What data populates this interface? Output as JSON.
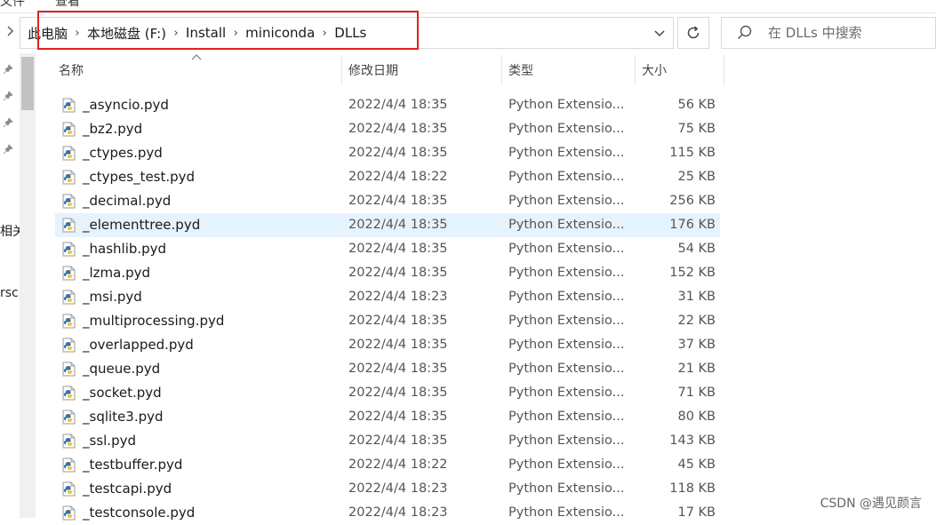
{
  "address": {
    "crumbs": [
      "此电脑",
      "本地磁盘 (F:)",
      "Install",
      "miniconda",
      "DLLs"
    ]
  },
  "search": {
    "placeholder": "在 DLLs 中搜索"
  },
  "ribbon": {
    "left_text": "文件",
    "right_text": "查看"
  },
  "left_pane": {
    "text_1": "相关",
    "text_2": "rsc"
  },
  "columns": {
    "name": "名称",
    "date": "修改日期",
    "type": "类型",
    "size": "大小"
  },
  "files": [
    {
      "name": "_asyncio.pyd",
      "date": "2022/4/4 18:35",
      "type": "Python Extensio...",
      "size": "56 KB"
    },
    {
      "name": "_bz2.pyd",
      "date": "2022/4/4 18:35",
      "type": "Python Extensio...",
      "size": "75 KB"
    },
    {
      "name": "_ctypes.pyd",
      "date": "2022/4/4 18:35",
      "type": "Python Extensio...",
      "size": "115 KB"
    },
    {
      "name": "_ctypes_test.pyd",
      "date": "2022/4/4 18:22",
      "type": "Python Extensio...",
      "size": "25 KB"
    },
    {
      "name": "_decimal.pyd",
      "date": "2022/4/4 18:35",
      "type": "Python Extensio...",
      "size": "256 KB"
    },
    {
      "name": "_elementtree.pyd",
      "date": "2022/4/4 18:35",
      "type": "Python Extensio...",
      "size": "176 KB",
      "selected": true
    },
    {
      "name": "_hashlib.pyd",
      "date": "2022/4/4 18:35",
      "type": "Python Extensio...",
      "size": "54 KB"
    },
    {
      "name": "_lzma.pyd",
      "date": "2022/4/4 18:35",
      "type": "Python Extensio...",
      "size": "152 KB"
    },
    {
      "name": "_msi.pyd",
      "date": "2022/4/4 18:23",
      "type": "Python Extensio...",
      "size": "31 KB"
    },
    {
      "name": "_multiprocessing.pyd",
      "date": "2022/4/4 18:35",
      "type": "Python Extensio...",
      "size": "22 KB"
    },
    {
      "name": "_overlapped.pyd",
      "date": "2022/4/4 18:35",
      "type": "Python Extensio...",
      "size": "37 KB"
    },
    {
      "name": "_queue.pyd",
      "date": "2022/4/4 18:35",
      "type": "Python Extensio...",
      "size": "21 KB"
    },
    {
      "name": "_socket.pyd",
      "date": "2022/4/4 18:35",
      "type": "Python Extensio...",
      "size": "71 KB"
    },
    {
      "name": "_sqlite3.pyd",
      "date": "2022/4/4 18:35",
      "type": "Python Extensio...",
      "size": "80 KB"
    },
    {
      "name": "_ssl.pyd",
      "date": "2022/4/4 18:35",
      "type": "Python Extensio...",
      "size": "143 KB"
    },
    {
      "name": "_testbuffer.pyd",
      "date": "2022/4/4 18:22",
      "type": "Python Extensio...",
      "size": "45 KB"
    },
    {
      "name": "_testcapi.pyd",
      "date": "2022/4/4 18:23",
      "type": "Python Extensio...",
      "size": "118 KB"
    },
    {
      "name": "_testconsole.pyd",
      "date": "2022/4/4 18:23",
      "type": "Python Extensio...",
      "size": "17 KB"
    }
  ],
  "watermark": "CSDN @遇见颜言",
  "colors": {
    "accent_red": "#e02020",
    "selected_row": "#e5f3ff",
    "python_blue": "#3572a5",
    "python_yellow": "#f5c518"
  }
}
